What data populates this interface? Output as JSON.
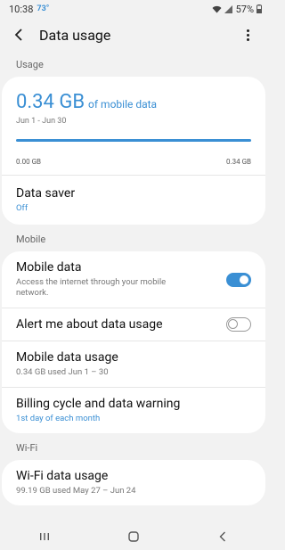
{
  "status": {
    "time": "10:38",
    "temperature": "73°",
    "battery": "57%"
  },
  "app_bar": {
    "title": "Data usage"
  },
  "usage_section": {
    "header": "Usage",
    "amount": "0.34 GB",
    "amount_suffix": "of mobile data",
    "range": "Jun 1 - Jun 30",
    "scale_min": "0.00 GB",
    "scale_max": "0.34 GB",
    "bar_fill_fraction": 1.0,
    "data_saver_label": "Data saver",
    "data_saver_value": "Off"
  },
  "mobile_section": {
    "header": "Mobile",
    "mobile_data_label": "Mobile data",
    "mobile_data_sub": "Access the internet through your mobile network.",
    "mobile_data_on": true,
    "alert_label": "Alert me about data usage",
    "alert_on": false,
    "mobile_usage_label": "Mobile data usage",
    "mobile_usage_sub": "0.34 GB used Jun 1 – 30",
    "billing_label": "Billing cycle and data warning",
    "billing_sub": "1st day of each month"
  },
  "wifi_section": {
    "header": "Wi-Fi",
    "wifi_usage_label": "Wi-Fi data usage",
    "wifi_usage_sub": "99.19 GB used May 27 – Jun 24"
  },
  "colors": {
    "accent": "#3a8fd4",
    "background": "#f2f2f2",
    "card": "#ffffff"
  }
}
